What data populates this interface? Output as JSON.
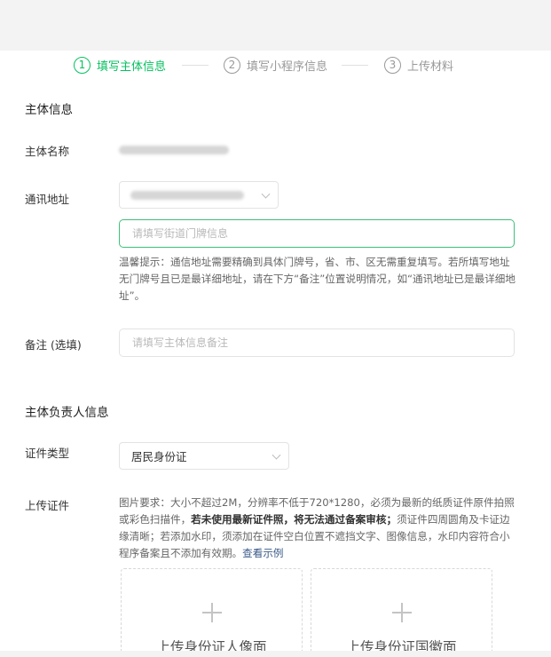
{
  "steps": [
    {
      "num": "1",
      "label": "填写主体信息",
      "state": "active"
    },
    {
      "num": "2",
      "label": "填写小程序信息",
      "state": "inactive"
    },
    {
      "num": "3",
      "label": "上传材料",
      "state": "inactive"
    }
  ],
  "subject_section": {
    "title": "主体信息",
    "name_label": "主体名称",
    "address_label": "通讯地址",
    "street_placeholder": "请填写街道门牌信息",
    "hint": {
      "text": "温馨提示：通信地址需要精确到具体门牌号，省、市、区无需重复填写。若所填写地址无门牌号且已是最详细地址，请在下方“备注”位置说明情况，如“通讯地址已是最详细地址”。"
    },
    "remark_label": "备注 (选填)",
    "remark_placeholder": "请填写主体信息备注"
  },
  "responsible_section": {
    "title": "主体负责人信息",
    "cert_type_label": "证件类型",
    "cert_type_value": "居民身份证",
    "upload_label": "上传证件",
    "upload_hint": {
      "part1": "图片要求：大小不超过2M，分辨率不低于720*1280，必须为最新的纸质证件原件拍照或彩色扫描件，",
      "bold": "若未使用最新证件照，将无法通过备案审核；",
      "part2": "须证件四周圆角及卡证边缘清晰；若添加水印，须添加在证件空白位置不遮挡文字、图像信息，水印内容符合小程序备案且不添加有效期。",
      "link": "查看示例"
    },
    "upload_front": "上传身份证人像面",
    "upload_back": "上传身份证国徽面"
  },
  "colors": {
    "accent": "#07c160",
    "link": "#3b5a88",
    "topbar": "#f3f3f3"
  },
  "icons": [
    "chevron-down-icon",
    "plus-icon"
  ]
}
